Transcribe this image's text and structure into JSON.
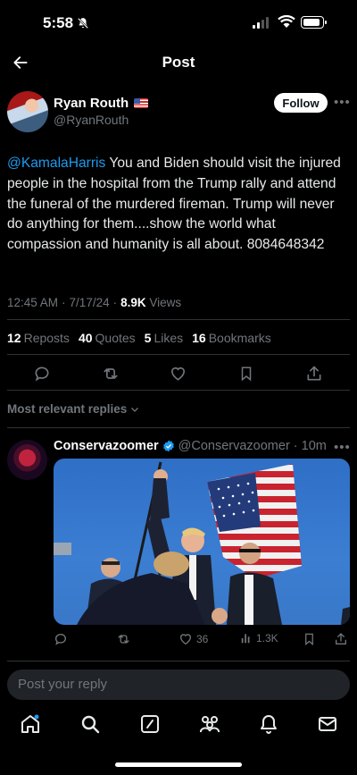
{
  "status_bar": {
    "time": "5:58"
  },
  "header": {
    "title": "Post"
  },
  "post": {
    "author_name": "Ryan Routh",
    "author_handle": "@RyanRouth",
    "follow_label": "Follow",
    "mention": "@KamalaHarris",
    "text": " You and Biden should visit the injured people in the hospital from the Trump rally and attend the funeral of the murdered fireman. Trump will never do anything for them....show the world what compassion and humanity is all about. 8084648342",
    "time": "12:45 AM",
    "date": "7/17/24",
    "views_count": "8.9K",
    "views_label": "Views",
    "stats": [
      {
        "count": "12",
        "label": "Reposts"
      },
      {
        "count": "40",
        "label": "Quotes"
      },
      {
        "count": "5",
        "label": "Likes"
      },
      {
        "count": "16",
        "label": "Bookmarks"
      }
    ]
  },
  "replies_filter": "Most relevant replies",
  "reply": {
    "author_name": "Conservazoomer",
    "author_handle": "@Conservazoomer",
    "age": "10m",
    "likes": "36",
    "views": "1.3K"
  },
  "composer": {
    "placeholder": "Post your reply"
  },
  "colors": {
    "accent": "#1d9bf0",
    "background": "#000000",
    "muted": "#71767b",
    "divider": "#2f3336"
  },
  "icons": [
    "silent-bell-icon",
    "back-arrow-icon",
    "more-icon",
    "reply-icon",
    "repost-icon",
    "like-icon",
    "bookmark-icon",
    "share-icon",
    "chevron-down-icon",
    "verified-badge-icon",
    "views-icon",
    "home-icon",
    "search-icon",
    "grok-icon",
    "communities-icon",
    "notifications-icon",
    "messages-icon"
  ]
}
